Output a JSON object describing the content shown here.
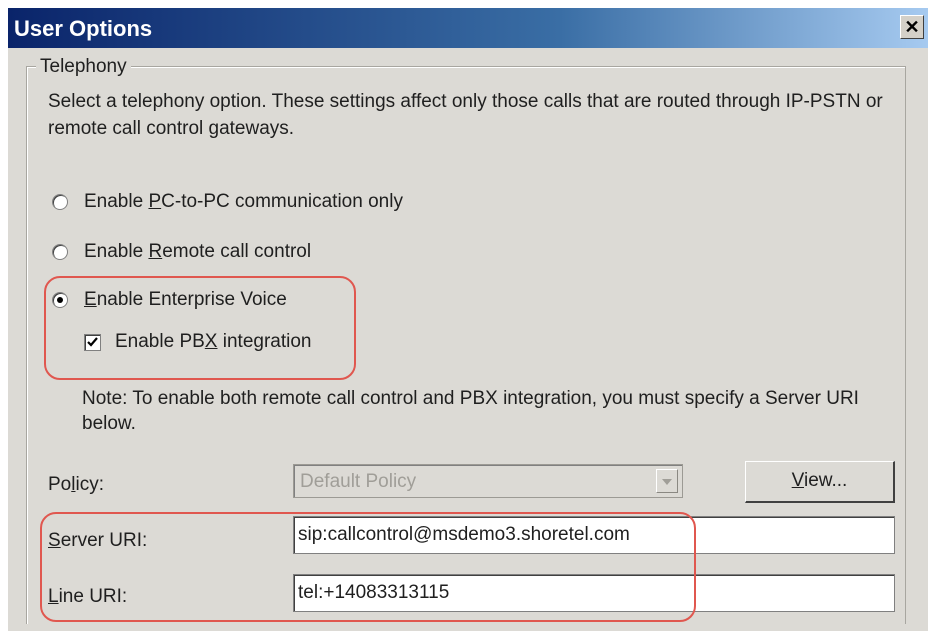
{
  "window": {
    "title": "User Options",
    "close_glyph": "✕"
  },
  "telephony": {
    "group_label": "Telephony",
    "description": "Select a telephony option. These settings affect only those calls that are routed through IP-PSTN or remote call control gateways.",
    "options": [
      {
        "label": "Enable PC-to-PC communication only",
        "selected": false
      },
      {
        "label": "Enable Remote call control",
        "selected": false
      },
      {
        "label": "Enable Enterprise Voice",
        "selected": true
      }
    ],
    "pbx_checkbox": {
      "label": "Enable PBX integration",
      "checked": true
    },
    "note": "Note: To enable both remote call control and PBX integration, you must specify a Server URI below."
  },
  "policy": {
    "label": "Policy:",
    "value": "Default Policy",
    "view_button": "View..."
  },
  "server_uri": {
    "label": "Server URI:",
    "value": "sip:callcontrol@msdemo3.shoretel.com"
  },
  "line_uri": {
    "label": "Line URI:",
    "value": "tel:+14083313115"
  },
  "colors": {
    "highlight": "#e0574f",
    "dialog_bg": "#dcdad5",
    "titlebar": "#0a246a"
  }
}
